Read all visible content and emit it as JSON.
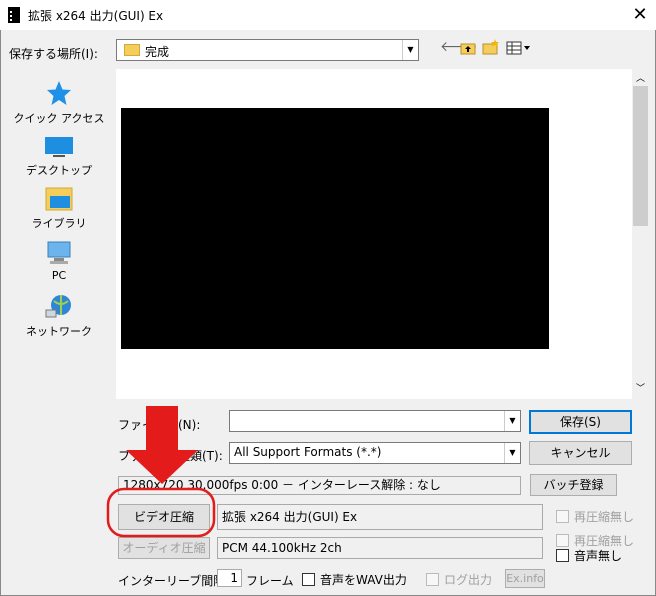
{
  "window": {
    "title": "拡張 x264 出力(GUI) Ex"
  },
  "save_location": {
    "label": "保存する場所(I):",
    "value": "完成"
  },
  "sidebar": {
    "items": [
      {
        "label": "クイック アクセス"
      },
      {
        "label": "デスクトップ"
      },
      {
        "label": "ライブラリ"
      },
      {
        "label": "PC"
      },
      {
        "label": "ネットワーク"
      }
    ]
  },
  "filename": {
    "label": "ファイル名(N):",
    "value": ""
  },
  "filetype": {
    "label": "ファイルの種類(T):",
    "value": "All Support Formats (*.*)"
  },
  "buttons": {
    "save": "保存(S)",
    "cancel": "キャンセル",
    "batch": "バッチ登録",
    "video": "ビデオ圧縮",
    "audio": "オーディオ圧縮",
    "exinfo": "Ex.info"
  },
  "info": {
    "video_info": "1280x720  30.000fps  0:00  －  インターレース解除 : なし",
    "video_codec": "拡張 x264 出力(GUI) Ex",
    "audio_codec": "PCM 44.100kHz 2ch"
  },
  "checkboxes": {
    "recompress_none_1": "再圧縮無し",
    "recompress_none_2": "再圧縮無し",
    "audio_none": "音声無し",
    "wav_output": "音声をWAV出力",
    "log_output": "ログ出力"
  },
  "interleave": {
    "label": "インターリーブ間隔 :",
    "value": "1",
    "unit": "フレーム"
  },
  "colors": {
    "annotation_red": "#e31b1b",
    "accent": "#0078d7"
  }
}
